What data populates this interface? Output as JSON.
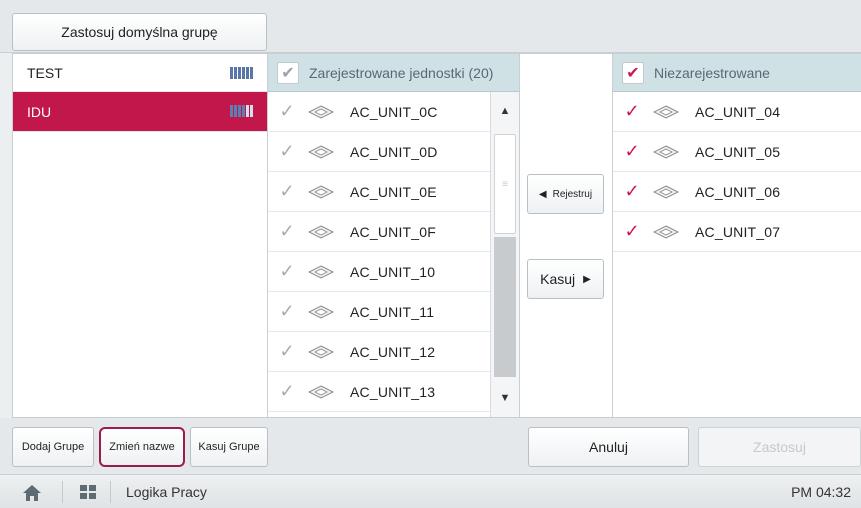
{
  "toolbar": {
    "apply_default_label": "Zastosuj domyślna grupę"
  },
  "groups": [
    {
      "name": "TEST"
    },
    {
      "name": "IDU"
    }
  ],
  "registered": {
    "header": "Zarejestrowane jednostki (20)",
    "units": [
      "AC_UNIT_0C",
      "AC_UNIT_0D",
      "AC_UNIT_0E",
      "AC_UNIT_0F",
      "AC_UNIT_10",
      "AC_UNIT_11",
      "AC_UNIT_12",
      "AC_UNIT_13"
    ]
  },
  "middle": {
    "register_label": "Rejestruj",
    "delete_label": "Kasuj"
  },
  "unregistered": {
    "header": "Niezarejestrowane",
    "units": [
      "AC_UNIT_04",
      "AC_UNIT_05",
      "AC_UNIT_06",
      "AC_UNIT_07"
    ]
  },
  "actions": {
    "add_group": "Dodaj Grupe",
    "rename_group": "Zmień nazwe",
    "delete_group": "Kasuj Grupe",
    "cancel": "Anuluj",
    "apply": "Zastosuj"
  },
  "statusbar": {
    "page_name": "Logika Pracy",
    "time": "PM 04:32"
  },
  "colors": {
    "accent": "#c2174a",
    "check": "#d0145b",
    "header_bg": "#cfe1e4"
  }
}
